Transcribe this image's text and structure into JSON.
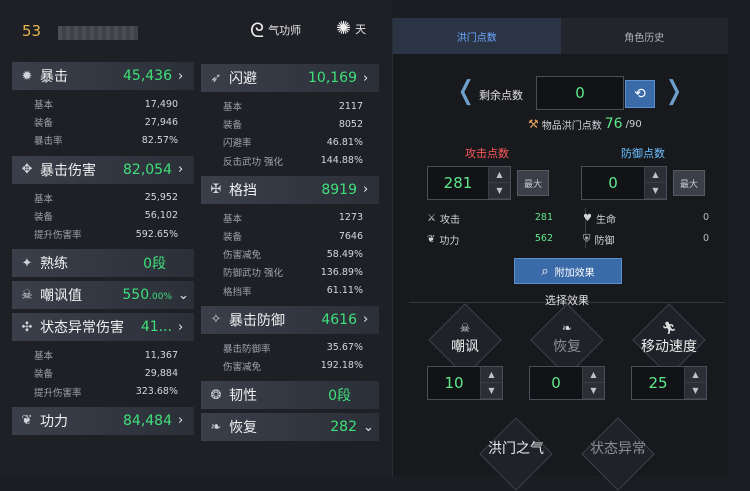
{
  "header": {
    "level": "53",
    "class_label": "气功师",
    "sect_label": "天"
  },
  "left_col": [
    {
      "name": "暴击",
      "value": "45,436",
      "icon": "burst-icon",
      "arrow": "›",
      "rows": [
        [
          "基本",
          "17,490"
        ],
        [
          "装备",
          "27,946"
        ],
        [
          "暴击率",
          "82.57%"
        ]
      ]
    },
    {
      "name": "暴击伤害",
      "value": "82,054",
      "icon": "crit-damage-icon",
      "arrow": "›",
      "rows": [
        [
          "基本",
          "25,952"
        ],
        [
          "装备",
          "56,102"
        ],
        [
          "提升伤害率",
          "592.65%"
        ]
      ]
    },
    {
      "name": "熟练",
      "value": "0段",
      "icon": "mastery-icon",
      "arrow": "",
      "rows": []
    },
    {
      "name": "嘲讽值",
      "value": "550",
      "suffix": ".00%",
      "icon": "skull-icon",
      "arrow": "⌄",
      "rows": []
    },
    {
      "name": "状态异常伤害",
      "value": "41...",
      "icon": "status-damage-icon",
      "arrow": "›",
      "rows": [
        [
          "基本",
          "11,367"
        ],
        [
          "装备",
          "29,884"
        ],
        [
          "提升伤害率",
          "323.68%"
        ]
      ]
    },
    {
      "name": "功力",
      "value": "84,484",
      "icon": "power-icon",
      "arrow": "›",
      "rows": []
    }
  ],
  "mid_col": [
    {
      "name": "闪避",
      "value": "10,169",
      "icon": "evade-icon",
      "arrow": "›",
      "rows": [
        [
          "基本",
          "2117"
        ],
        [
          "装备",
          "8052"
        ],
        [
          "闪避率",
          "46.81%"
        ],
        [
          "反击武功 强化",
          "144.88%"
        ]
      ]
    },
    {
      "name": "格挡",
      "value": "8919",
      "icon": "block-icon",
      "arrow": "›",
      "rows": [
        [
          "基本",
          "1273"
        ],
        [
          "装备",
          "7646"
        ],
        [
          "伤害减免",
          "58.49%"
        ],
        [
          "防御武功 强化",
          "136.89%"
        ],
        [
          "格挡率",
          "61.11%"
        ]
      ]
    },
    {
      "name": "暴击防御",
      "value": "4616",
      "icon": "crit-defense-icon",
      "arrow": "›",
      "rows": [
        [
          "暴击防御率",
          "35.67%"
        ],
        [
          "伤害减免",
          "192.18%"
        ]
      ]
    },
    {
      "name": "韧性",
      "value": "0段",
      "icon": "toughness-icon",
      "arrow": "",
      "rows": []
    },
    {
      "name": "恢复",
      "value": "282",
      "icon": "recover-icon",
      "arrow": "⌄",
      "rows": []
    }
  ],
  "right": {
    "tabs": [
      "洪门点数",
      "角色历史"
    ],
    "remaining_label": "剩余点数",
    "remaining_value": "0",
    "item_points_label": "物品洪门点数",
    "item_points_value": "76",
    "item_points_max": "/90",
    "attack_label": "攻击点数",
    "defense_label": "防御点数",
    "attack_value": "281",
    "defense_value": "0",
    "max_label": "最大",
    "attack_stats": [
      [
        "攻击",
        "281"
      ],
      [
        "功力",
        "562"
      ]
    ],
    "defense_stats": [
      [
        "生命",
        "0"
      ],
      [
        "防御",
        "0"
      ]
    ],
    "add_effect_label": "附加效果",
    "select_effect_label": "选择效果",
    "effects": [
      {
        "name": "嘲讽",
        "value": "10"
      },
      {
        "name": "恢复",
        "value": "0"
      },
      {
        "name": "移动速度",
        "value": "25"
      }
    ],
    "effects2": [
      "洪门之气",
      "状态异常"
    ]
  }
}
